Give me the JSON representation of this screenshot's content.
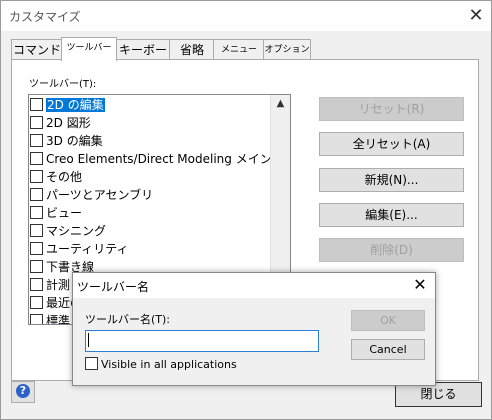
{
  "window": {
    "title": "カスタマイズ",
    "close_glyph": "✕"
  },
  "tabs": [
    {
      "label": "コマンド"
    },
    {
      "label": "ツールバー"
    },
    {
      "label": "キーボード"
    },
    {
      "label": "省略"
    },
    {
      "label": "メニュー"
    },
    {
      "label": "オプション"
    }
  ],
  "toolbar_list": {
    "label": "ツールバー(T):",
    "items": [
      {
        "label": "2D の編集",
        "checked": false,
        "selected": true
      },
      {
        "label": "2D 図形",
        "checked": false
      },
      {
        "label": "3D の編集",
        "checked": false
      },
      {
        "label": "Creo Elements/Direct Modeling メインタスク",
        "checked": false
      },
      {
        "label": "その他",
        "checked": false
      },
      {
        "label": "パーツとアセンブリ",
        "checked": false
      },
      {
        "label": "ビュー",
        "checked": false
      },
      {
        "label": "マシニング",
        "checked": false
      },
      {
        "label": "ユーティリティ",
        "checked": false
      },
      {
        "label": "下書き線",
        "checked": false
      },
      {
        "label": "計測",
        "checked": false
      },
      {
        "label": "最近の",
        "checked": false
      },
      {
        "label": "標準",
        "checked": false
      }
    ],
    "scroll_up_glyph": "▲"
  },
  "buttons": {
    "reset": "リセット(R)",
    "reset_all": "全リセット(A)",
    "new": "新規(N)...",
    "edit": "編集(E)...",
    "delete": "削除(D)",
    "close": "閉じる",
    "help": "?"
  },
  "subdialog": {
    "title": "ツールバー名",
    "close_glyph": "✕",
    "field_label": "ツールバー名(T):",
    "field_value": "",
    "ok": "OK",
    "cancel": "Cancel",
    "visible_label": "Visible in all applications"
  }
}
